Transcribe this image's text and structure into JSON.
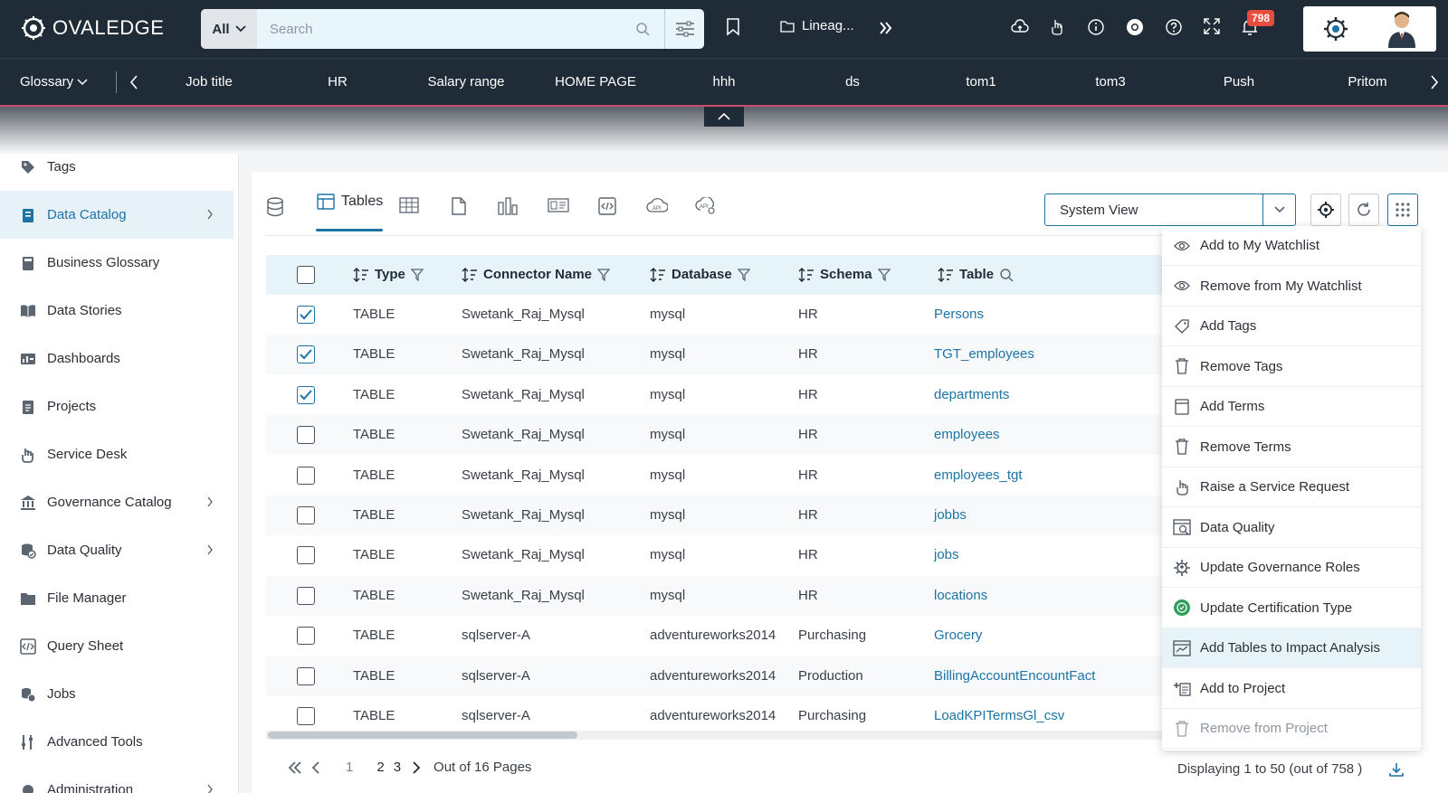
{
  "app": {
    "brand": "OVALEDGE"
  },
  "search": {
    "scope": "All",
    "placeholder": "Search"
  },
  "topbar": {
    "lineage_label": "Lineag...",
    "notification_count": "798"
  },
  "secnav": {
    "module": "Glossary",
    "items": [
      "Job title",
      "HR",
      "Salary range",
      "HOME PAGE",
      "hhh",
      "ds",
      "tom1",
      "tom3",
      "Push",
      "Pritom"
    ]
  },
  "sidebar": {
    "items": [
      {
        "label": "Tags",
        "icon": "tag-icon"
      },
      {
        "label": "Data Catalog",
        "icon": "catalog-icon",
        "active": true,
        "chevron": true
      },
      {
        "label": "Business Glossary",
        "icon": "glossary-icon"
      },
      {
        "label": "Data Stories",
        "icon": "book-icon"
      },
      {
        "label": "Dashboards",
        "icon": "dashboard-icon"
      },
      {
        "label": "Projects",
        "icon": "projects-icon"
      },
      {
        "label": "Service Desk",
        "icon": "service-desk-icon"
      },
      {
        "label": "Governance Catalog",
        "icon": "bank-icon",
        "chevron": true
      },
      {
        "label": "Data Quality",
        "icon": "data-quality-icon",
        "chevron": true
      },
      {
        "label": "File Manager",
        "icon": "folder-icon"
      },
      {
        "label": "Query Sheet",
        "icon": "code-icon"
      },
      {
        "label": "Jobs",
        "icon": "jobs-icon"
      },
      {
        "label": "Advanced Tools",
        "icon": "tools-icon"
      },
      {
        "label": "Administration",
        "icon": "admin-icon",
        "chevron": true
      }
    ]
  },
  "main": {
    "active_tab": "Tables",
    "view_select": "System View",
    "columns": [
      "Type",
      "Connector Name",
      "Database",
      "Schema",
      "Table"
    ],
    "rows": [
      {
        "checked": true,
        "type": "TABLE",
        "connector": "Swetank_Raj_Mysql",
        "database": "mysql",
        "schema": "HR",
        "table": "Persons"
      },
      {
        "checked": true,
        "type": "TABLE",
        "connector": "Swetank_Raj_Mysql",
        "database": "mysql",
        "schema": "HR",
        "table": "TGT_employees"
      },
      {
        "checked": true,
        "type": "TABLE",
        "connector": "Swetank_Raj_Mysql",
        "database": "mysql",
        "schema": "HR",
        "table": "departments"
      },
      {
        "checked": false,
        "type": "TABLE",
        "connector": "Swetank_Raj_Mysql",
        "database": "mysql",
        "schema": "HR",
        "table": "employees"
      },
      {
        "checked": false,
        "type": "TABLE",
        "connector": "Swetank_Raj_Mysql",
        "database": "mysql",
        "schema": "HR",
        "table": "employees_tgt"
      },
      {
        "checked": false,
        "type": "TABLE",
        "connector": "Swetank_Raj_Mysql",
        "database": "mysql",
        "schema": "HR",
        "table": "jobbs"
      },
      {
        "checked": false,
        "type": "TABLE",
        "connector": "Swetank_Raj_Mysql",
        "database": "mysql",
        "schema": "HR",
        "table": "jobs"
      },
      {
        "checked": false,
        "type": "TABLE",
        "connector": "Swetank_Raj_Mysql",
        "database": "mysql",
        "schema": "HR",
        "table": "locations"
      },
      {
        "checked": false,
        "type": "TABLE",
        "connector": "sqlserver-A",
        "database": "adventureworks2014",
        "schema": "Purchasing",
        "table": "Grocery"
      },
      {
        "checked": false,
        "type": "TABLE",
        "connector": "sqlserver-A",
        "database": "adventureworks2014",
        "schema": "Production",
        "table": "BillingAccountEncountFact"
      },
      {
        "checked": false,
        "type": "TABLE",
        "connector": "sqlserver-A",
        "database": "adventureworks2014",
        "schema": "Purchasing",
        "table": "LoadKPITermsGl_csv"
      }
    ],
    "pager": {
      "pages": [
        "1",
        "2",
        "3"
      ],
      "total_text": "Out of 16 Pages"
    },
    "displaying": "Displaying 1 to 50  (out of 758 )"
  },
  "menu": {
    "items": [
      {
        "label": "Add to My Watchlist",
        "icon": "eye-icon"
      },
      {
        "label": "Remove from My Watchlist",
        "icon": "eye-icon"
      },
      {
        "label": "Add Tags",
        "icon": "tag-icon"
      },
      {
        "label": "Remove Tags",
        "icon": "trash-icon"
      },
      {
        "label": "Add Terms",
        "icon": "terms-icon"
      },
      {
        "label": "Remove Terms",
        "icon": "trash-icon"
      },
      {
        "label": "Raise a Service Request",
        "icon": "service-request-icon"
      },
      {
        "label": "Data Quality",
        "icon": "data-quality-icon"
      },
      {
        "label": "Update Governance Roles",
        "icon": "governance-roles-icon"
      },
      {
        "label": "Update Certification Type",
        "icon": "certification-icon"
      },
      {
        "label": "Add Tables to Impact Analysis",
        "icon": "impact-analysis-icon",
        "highlight": true
      },
      {
        "label": "Add to Project",
        "icon": "add-project-icon"
      },
      {
        "label": "Remove from Project",
        "icon": "trash-icon",
        "disabled": true
      }
    ]
  },
  "colors": {
    "accent": "#1c73a6",
    "topbar": "#1f2b36",
    "header_bg": "#e6f4fa",
    "badge": "#e74c3c"
  }
}
